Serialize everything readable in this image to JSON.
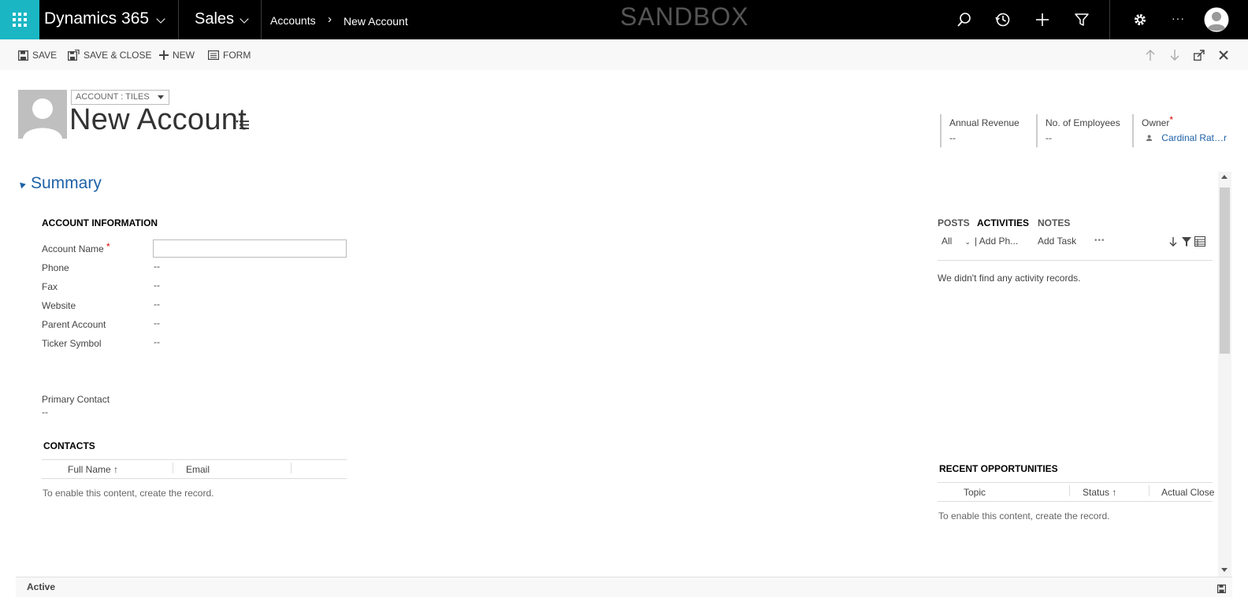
{
  "topnav": {
    "app_name": "Dynamics 365",
    "module": "Sales",
    "breadcrumb_parent": "Accounts",
    "breadcrumb_current": "New Account",
    "environment": "SANDBOX",
    "more": "···",
    "brand_color": "#1ab6c4"
  },
  "toolbar": {
    "save": "SAVE",
    "save_close": "SAVE & CLOSE",
    "new": "NEW",
    "form": "FORM"
  },
  "header": {
    "form_selector": "ACCOUNT : TILES",
    "title": "New Account",
    "fields": [
      {
        "label": "Annual Revenue",
        "value": "--"
      },
      {
        "label": "No. of Employees",
        "value": "--"
      },
      {
        "label": "Owner",
        "value": "Cardinal Rat…r",
        "required": "*"
      }
    ]
  },
  "summary": {
    "title": "Summary",
    "account_info": {
      "title": "ACCOUNT INFORMATION",
      "fields": [
        {
          "label": "Account Name",
          "value": "",
          "required": "*"
        },
        {
          "label": "Phone",
          "value": "--"
        },
        {
          "label": "Fax",
          "value": "--"
        },
        {
          "label": "Website",
          "value": "--"
        },
        {
          "label": "Parent Account",
          "value": "--"
        },
        {
          "label": "Ticker Symbol",
          "value": "--"
        }
      ],
      "primary_contact": {
        "label": "Primary Contact",
        "value": "--"
      }
    },
    "contacts": {
      "title": "CONTACTS",
      "columns": [
        "Full Name ↑",
        "Email"
      ],
      "empty_message": "To enable this content, create the record."
    }
  },
  "social": {
    "tabs": [
      "POSTS",
      "ACTIVITIES",
      "NOTES"
    ],
    "active_tab": "ACTIVITIES",
    "filter": "All",
    "add_phone": "| Add Ph...",
    "add_task": "Add Task",
    "more": "•••",
    "empty_message": "We didn't find any activity records."
  },
  "opportunities": {
    "title": "RECENT OPPORTUNITIES",
    "columns": [
      "Topic",
      "Status ↑",
      "Actual Close"
    ],
    "empty_message": "To enable this content, create the record."
  },
  "footer": {
    "status": "Active"
  }
}
